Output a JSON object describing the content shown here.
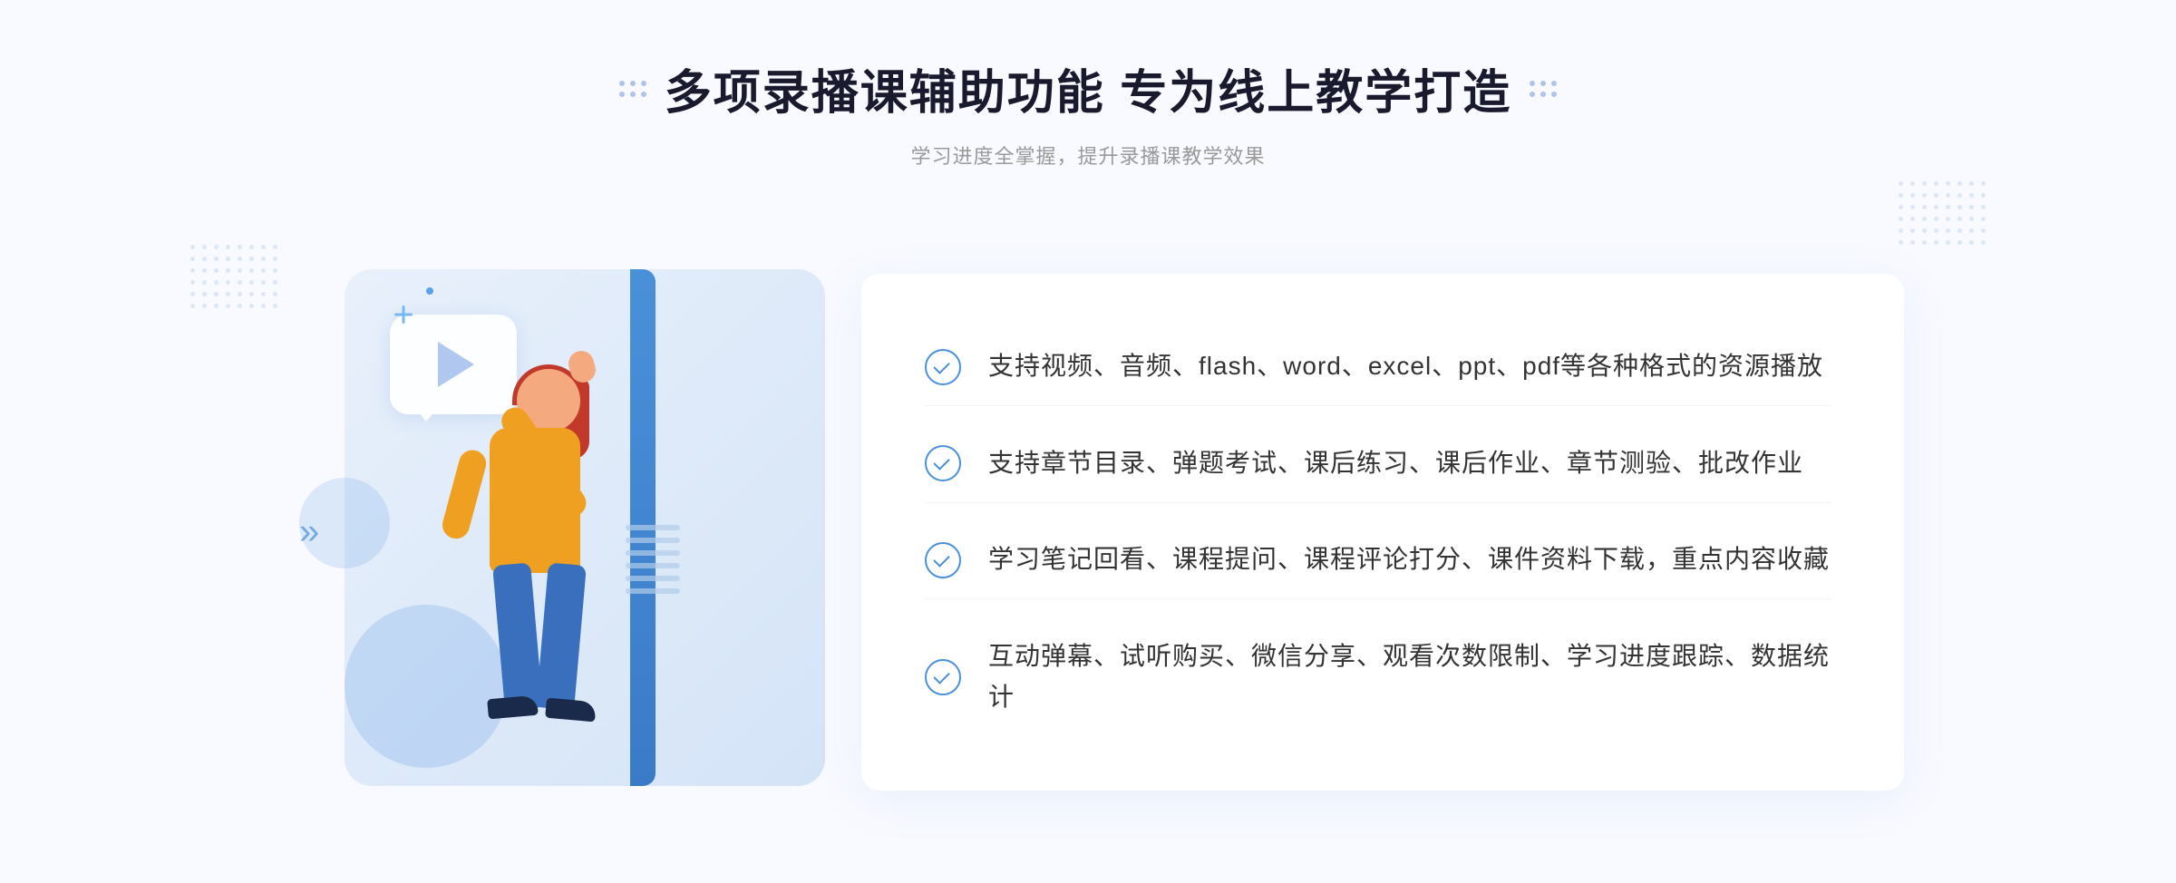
{
  "page": {
    "background_color": "#f5f8fe"
  },
  "header": {
    "title": "多项录播课辅助功能 专为线上教学打造",
    "subtitle": "学习进度全掌握，提升录播课教学效果",
    "decorator_left": "⁘",
    "decorator_right": "⁘"
  },
  "features": [
    {
      "id": 1,
      "text": "支持视频、音频、flash、word、excel、ppt、pdf等各种格式的资源播放"
    },
    {
      "id": 2,
      "text": "支持章节目录、弹题考试、课后练习、课后作业、章节测验、批改作业"
    },
    {
      "id": 3,
      "text": "学习笔记回看、课程提问、课程评论打分、课件资料下载，重点内容收藏"
    },
    {
      "id": 4,
      "text": "互动弹幕、试听购买、微信分享、观看次数限制、学习进度跟踪、数据统计"
    }
  ],
  "illustration": {
    "play_button_visible": true
  },
  "decorations": {
    "chevron_symbol": "»",
    "dot_color": "#c0d4ee"
  }
}
